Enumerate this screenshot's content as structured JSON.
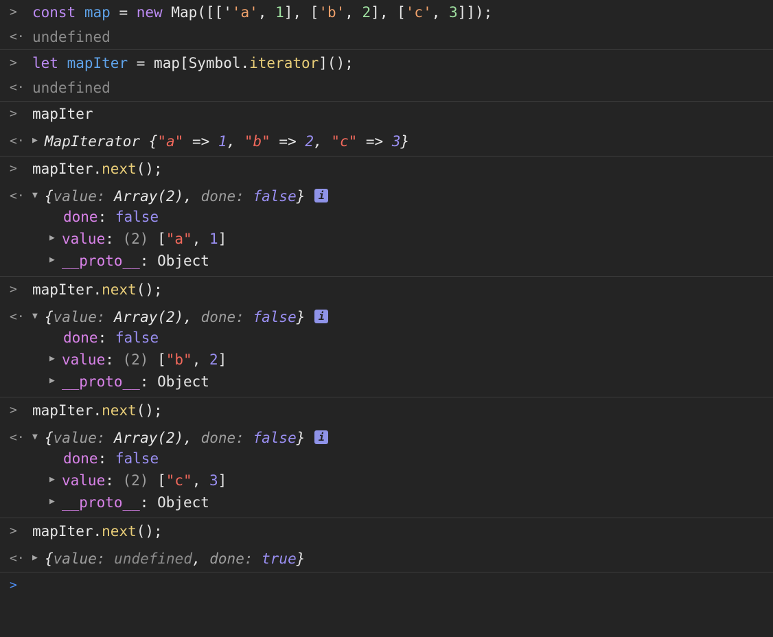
{
  "prompt_glyph": ">",
  "result_glyph": "<·",
  "expand_closed": "▶",
  "expand_open": "▼",
  "info_label": "i",
  "e1": {
    "kw": "const",
    "var": "map",
    "eq": " = ",
    "new": "new",
    "cls": " Map([['",
    "s1": "'a'",
    "c1": ", ",
    "n1": "1",
    "mid1": "], [",
    "s2": "'b'",
    "c2": ", ",
    "n2": "2",
    "mid2": "], [",
    "s3": "'c'",
    "c3": ", ",
    "n3": "3",
    "end": "]]);",
    "result": "undefined"
  },
  "e2": {
    "kw": "let",
    "var": "mapIter",
    "eq": " = ",
    "obj": "map[Symbol.",
    "prop": "iterator",
    "end": "]();",
    "result": "undefined"
  },
  "e3": {
    "input": "mapIter",
    "label": "MapIterator",
    "open": " {",
    "k1": "\"a\"",
    "arrow1": " => ",
    "v1": "1",
    "sep1": ", ",
    "k2": "\"b\"",
    "arrow2": " => ",
    "v2": "2",
    "sep2": ", ",
    "k3": "\"c\"",
    "arrow3": " => ",
    "v3": "3",
    "close": "}"
  },
  "next_call": {
    "obj": "mapIter.",
    "method": "next",
    "end": "();"
  },
  "summary": {
    "open": "{",
    "value_key": "value",
    "colon": ": ",
    "value_val": "Array(2)",
    "sep": ", ",
    "done_key": "done",
    "done_val": "false",
    "close": "}"
  },
  "props": {
    "done_key": "done",
    "done_val": "false",
    "value_key": "value",
    "value_len": "(2)",
    "proto_key": "__proto__",
    "proto_val": "Object"
  },
  "iter1": {
    "s": "\"a\"",
    "n": "1"
  },
  "iter2": {
    "s": "\"b\"",
    "n": "2"
  },
  "iter3": {
    "s": "\"c\"",
    "n": "3"
  },
  "final": {
    "open": "{",
    "value_key": "value",
    "colon": ": ",
    "value_val": "undefined",
    "sep": ", ",
    "done_key": "done",
    "done_val": "true",
    "close": "}"
  }
}
